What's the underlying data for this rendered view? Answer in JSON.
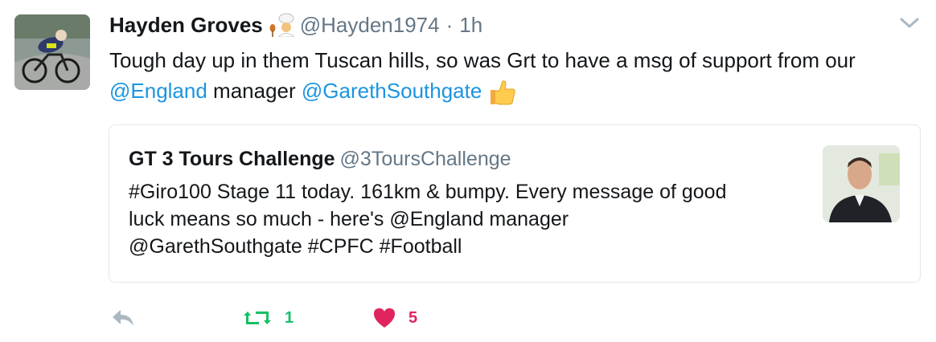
{
  "tweet": {
    "author_name": "Hayden Groves",
    "author_handle": "@Hayden1974",
    "separator": "·",
    "time": "1h",
    "text_part1": "Tough day up in them Tuscan hills, so was Grt to have a msg of support from our ",
    "mention1": "@England",
    "text_part2": " manager ",
    "mention2": "@GarethSouthgate",
    "avatar_icon": "cyclist-avatar",
    "header_emoji": "chef-emoji",
    "text_emoji": "thumbs-up-emoji",
    "menu_icon": "chevron-down-icon"
  },
  "quoted_tweet": {
    "author_name": "GT 3 Tours Challenge",
    "author_handle": "@3ToursChallenge",
    "text_line1": "#Giro100 Stage 11 today. 161km & bumpy. Every message of good",
    "text_line2": "luck means so much - here's @England manager",
    "text_line3": "@GarethSouthgate #CPFC #Football",
    "thumbnail": "man-in-suit-photo"
  },
  "actions": {
    "reply_icon": "reply-icon",
    "retweet_icon": "retweet-icon",
    "retweet_count": "1",
    "like_icon": "heart-icon",
    "like_count": "5"
  },
  "colors": {
    "link": "#1b95e0",
    "muted": "#657786",
    "retweet": "#17bf63",
    "like": "#e0245e",
    "border": "#e1e8ed"
  }
}
